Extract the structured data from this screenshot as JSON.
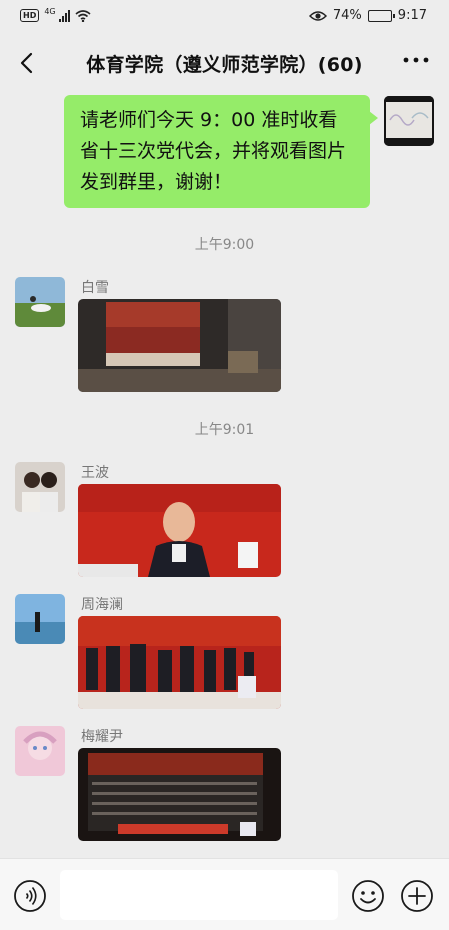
{
  "status_bar": {
    "hd_label": "HD",
    "signal_label": "4G",
    "battery_percent": "74%",
    "battery_level": 0.74,
    "time": "9:17"
  },
  "header": {
    "title": "体育学院（遵义师范学院）(60)"
  },
  "my_message": {
    "text": "请老师们今天 9：00 准时收看省十三次党代会，并将观看图片发到群里，谢谢！"
  },
  "timestamps": [
    "上午9:00",
    "上午9:01"
  ],
  "messages": [
    {
      "sender": "白雪",
      "content": "image"
    },
    {
      "sender": "王波",
      "content": "image"
    },
    {
      "sender": "周海澜",
      "content": "image"
    },
    {
      "sender": "梅耀尹",
      "content": "image"
    }
  ],
  "icons": [
    "back-arrow-icon",
    "more-icon",
    "voice-icon",
    "emoji-icon",
    "plus-icon",
    "eye-icon",
    "wifi-icon",
    "signal-icon",
    "battery-icon"
  ],
  "colors": {
    "background": "#ededed",
    "my_bubble": "#95ec69",
    "input_bar": "#f7f7f7"
  }
}
